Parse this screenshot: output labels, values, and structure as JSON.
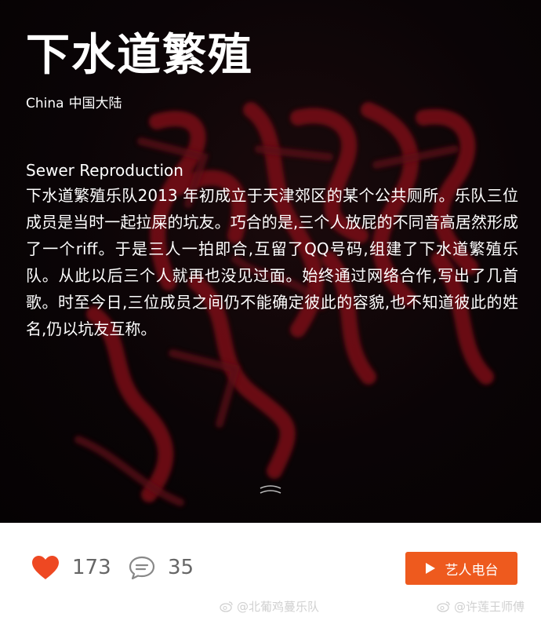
{
  "artist": {
    "name": "下水道繁殖",
    "country_en": "China",
    "country_zh": "中国大陆"
  },
  "description": {
    "english_name": "Sewer Reproduction",
    "text": "下水道繁殖乐队2013 年初成立于天津郊区的某个公共厕所。乐队三位成员是当时一起拉屎的坑友。巧合的是,三个人放屁的不同音高居然形成了一个riff。于是三人一拍即合,互留了QQ号码,组建了下水道繁殖乐队。从此以后三个人就再也没见过面。始终通过网络合作,写出了几首歌。时至今日,三位成员之间仍不能确定彼此的容貌,也不知道彼此的姓名,仍以坑友互称。"
  },
  "actions": {
    "likes": "173",
    "comments": "35",
    "radio_button": "艺人电台"
  },
  "watermarks": [
    "@北葡鸡蔓乐队",
    "@许莲王师傅"
  ],
  "icons": {
    "like": "heart-icon",
    "comment": "comment-icon",
    "play": "play-icon",
    "expand": "expand-chevron-icon",
    "weibo": "weibo-icon"
  },
  "colors": {
    "hero_bg": "#0a0406",
    "art_red": "#7a1018",
    "accent": "#ee5a1e",
    "heart": "#ee4822",
    "count_text": "#666666"
  }
}
